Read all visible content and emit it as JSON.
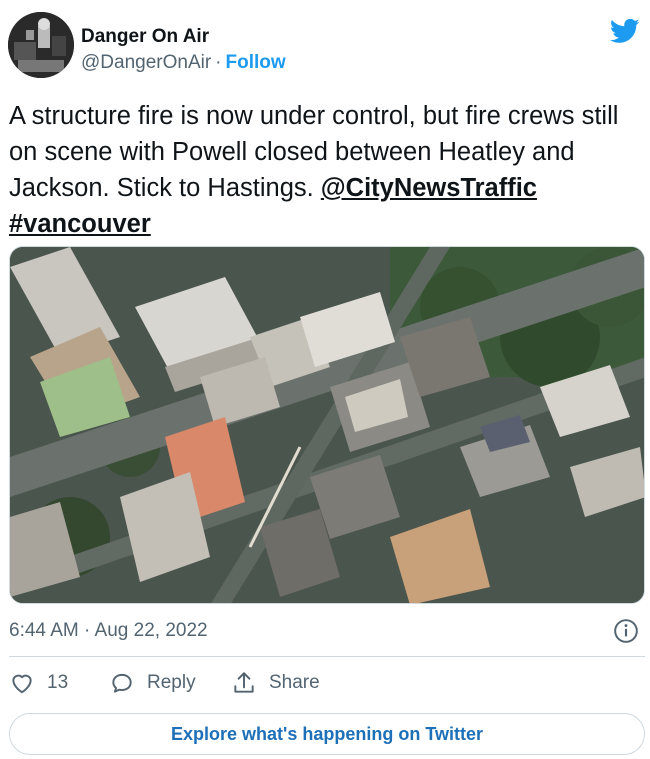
{
  "author": {
    "name": "Danger On Air",
    "handle": "@DangerOnAir",
    "separator": "·",
    "follow_label": "Follow"
  },
  "tweet": {
    "text_parts": [
      "A structure fire is now under control, but fire crews still on scene with Powell closed between Heatley and Jackson. Stick to Hastings. ",
      "@CityNewsTraffic",
      "#vancouver"
    ],
    "media_description_icon": "aerial-photo"
  },
  "meta": {
    "timestamp": "6:44 AM · Aug 22, 2022"
  },
  "actions": {
    "like_count": "13",
    "reply_label": "Reply",
    "share_label": "Share"
  },
  "explore_label": "Explore what's happening on Twitter",
  "colors": {
    "twitter_blue": "#1d9bf0",
    "text_primary": "#0f1419",
    "text_secondary": "#536471",
    "border": "#cfd9de"
  },
  "icons": [
    "twitter-bird-icon",
    "info-icon",
    "heart-icon",
    "reply-icon",
    "share-icon"
  ]
}
